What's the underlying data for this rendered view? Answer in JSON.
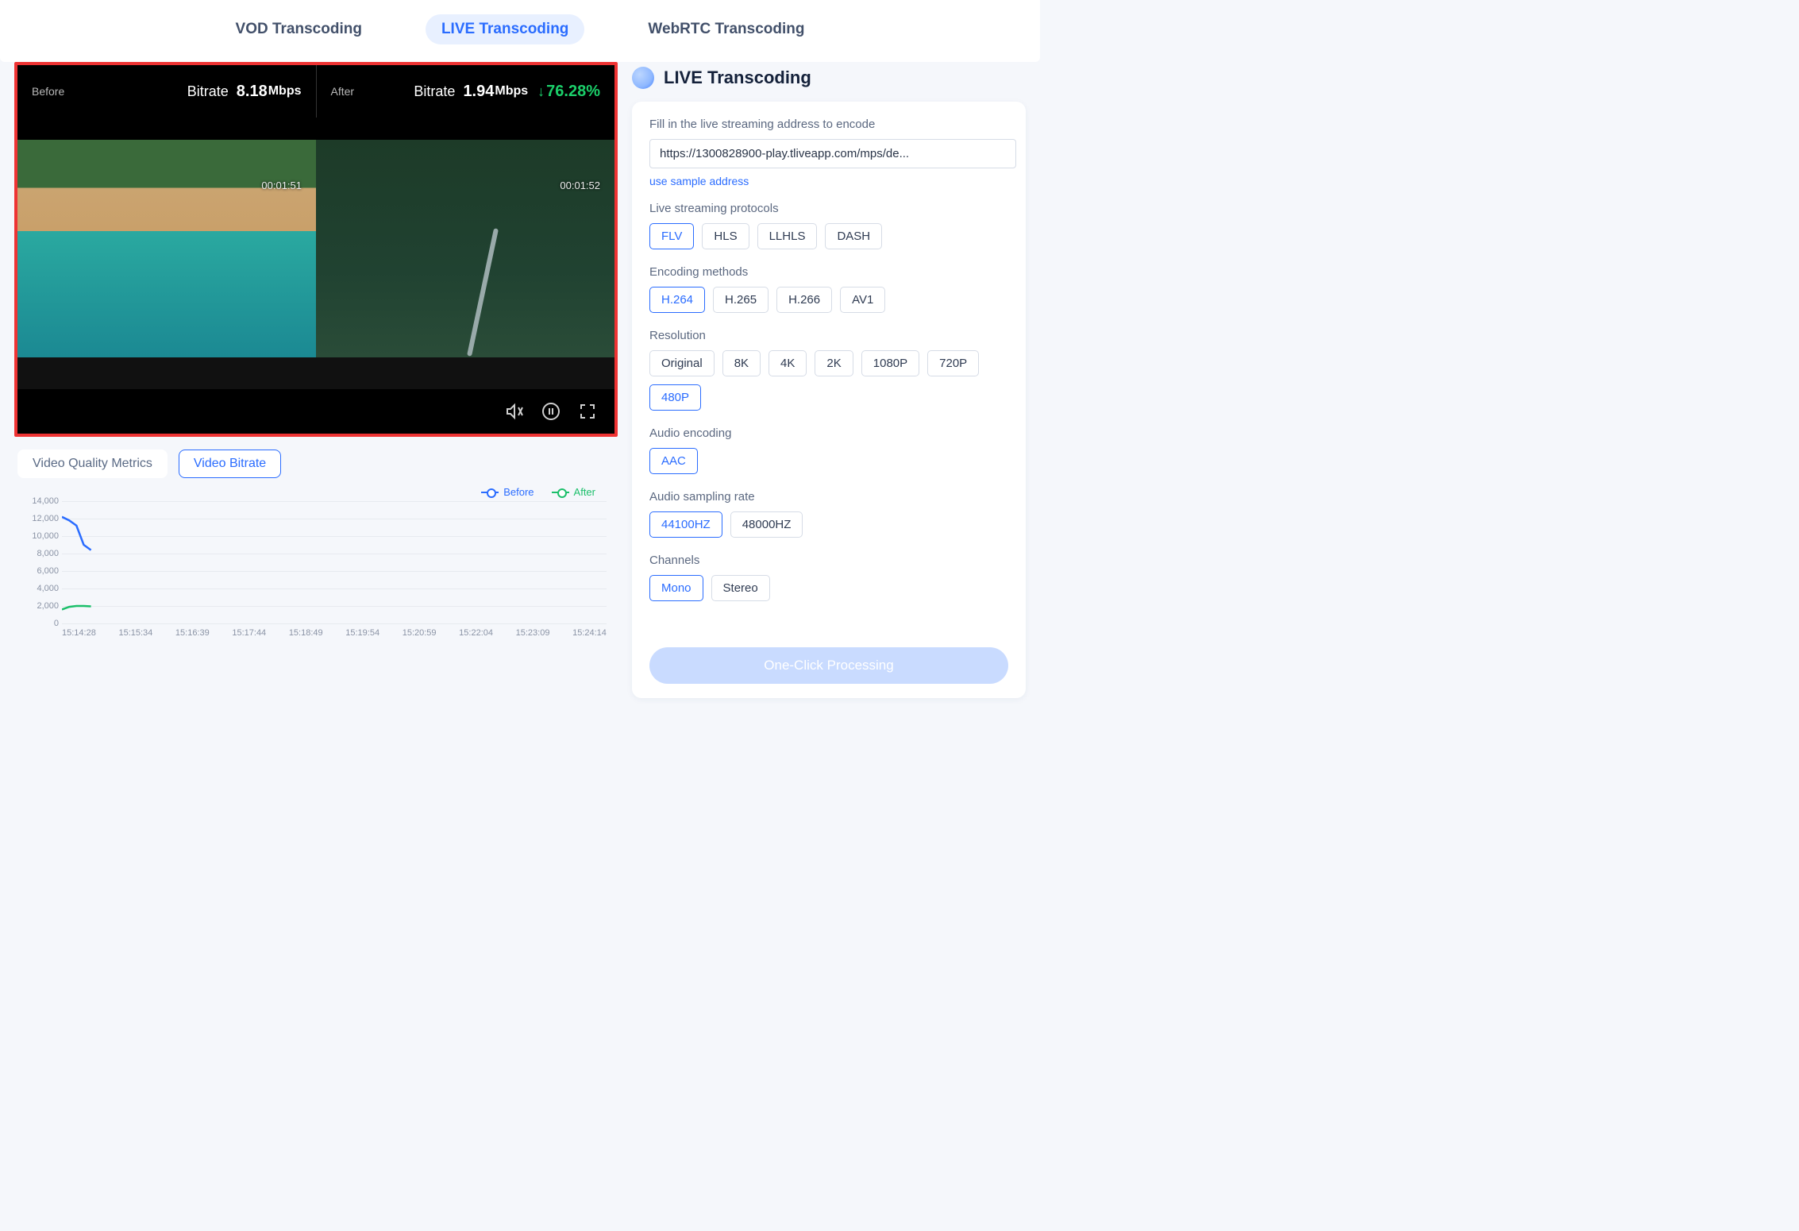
{
  "tabs": [
    {
      "label": "VOD Transcoding",
      "active": false
    },
    {
      "label": "LIVE Transcoding",
      "active": true
    },
    {
      "label": "WebRTC Transcoding",
      "active": false
    }
  ],
  "player": {
    "before": {
      "title": "Before",
      "bitrate_label": "Bitrate",
      "bitrate_value": "8.18",
      "bitrate_unit": "Mbps",
      "timecode": "00:01:51"
    },
    "after": {
      "title": "After",
      "bitrate_label": "Bitrate",
      "bitrate_value": "1.94",
      "bitrate_unit": "Mbps",
      "timecode": "00:01:52",
      "reduction_pct": "76.28%"
    }
  },
  "metric_tabs": [
    {
      "label": "Video Quality Metrics",
      "active": false
    },
    {
      "label": "Video Bitrate",
      "active": true
    }
  ],
  "legend": {
    "before": "Before",
    "after": "After"
  },
  "chart_data": {
    "type": "line",
    "title": "",
    "xlabel": "",
    "ylabel": "",
    "ylim": [
      0,
      14000
    ],
    "y_ticks": [
      0,
      2000,
      4000,
      6000,
      8000,
      10000,
      12000,
      14000
    ],
    "categories": [
      "15:14:28",
      "15:15:34",
      "15:16:39",
      "15:17:44",
      "15:18:49",
      "15:19:54",
      "15:20:59",
      "15:22:04",
      "15:23:09",
      "15:24:14"
    ],
    "series": [
      {
        "name": "Before",
        "color": "#2a6cff",
        "values": [
          12200,
          11800,
          11200,
          9000,
          8400,
          null,
          null,
          null,
          null,
          null
        ]
      },
      {
        "name": "After",
        "color": "#1bbf6a",
        "values": [
          1600,
          1900,
          2000,
          2000,
          1950,
          null,
          null,
          null,
          null,
          null
        ]
      }
    ]
  },
  "panel": {
    "title": "LIVE Transcoding",
    "address_label": "Fill in the live streaming address to encode",
    "address_value": "https://1300828900-play.tliveapp.com/mps/de...",
    "sample_link": "use sample address",
    "sections": {
      "protocols": {
        "label": "Live streaming protocols",
        "options": [
          "FLV",
          "HLS",
          "LLHLS",
          "DASH"
        ],
        "selected": "FLV"
      },
      "encoding": {
        "label": "Encoding methods",
        "options": [
          "H.264",
          "H.265",
          "H.266",
          "AV1"
        ],
        "selected": "H.264"
      },
      "resolution": {
        "label": "Resolution",
        "options": [
          "Original",
          "8K",
          "4K",
          "2K",
          "1080P",
          "720P",
          "480P"
        ],
        "selected": "480P"
      },
      "audio_enc": {
        "label": "Audio encoding",
        "options": [
          "AAC"
        ],
        "selected": "AAC"
      },
      "sample_rate": {
        "label": "Audio sampling rate",
        "options": [
          "44100HZ",
          "48000HZ"
        ],
        "selected": "44100HZ"
      },
      "channels": {
        "label": "Channels",
        "options": [
          "Mono",
          "Stereo"
        ],
        "selected": "Mono"
      }
    },
    "button": "One-Click Processing"
  }
}
